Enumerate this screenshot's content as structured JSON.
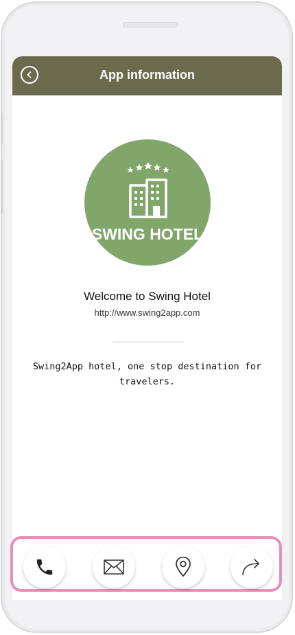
{
  "header": {
    "title": "App information",
    "back_icon": "back-arrow-icon",
    "color": "#6b6a4d"
  },
  "logo": {
    "text": "SWING HOTEL",
    "icon": "hotel-building-icon",
    "stars": 5,
    "color": "#80a66a"
  },
  "info": {
    "welcome": "Welcome to Swing Hotel",
    "website": "http://www.swing2app.com",
    "description": "Swing2App hotel, one stop destination for travelers."
  },
  "actions": [
    {
      "name": "call",
      "icon": "phone-icon"
    },
    {
      "name": "email",
      "icon": "mail-icon"
    },
    {
      "name": "location",
      "icon": "location-pin-icon"
    },
    {
      "name": "share",
      "icon": "share-icon"
    }
  ],
  "highlight_color": "#e78fbb"
}
